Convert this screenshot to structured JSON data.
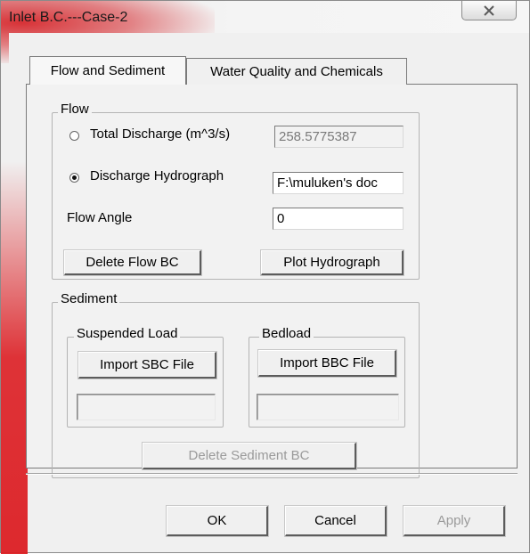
{
  "window": {
    "title": "Inlet B.C.---Case-2",
    "close_icon": "close-icon"
  },
  "tabs": [
    {
      "label": "Flow and Sediment",
      "active": true
    },
    {
      "label": "Water Quality and Chemicals",
      "active": false
    }
  ],
  "flow": {
    "group_label": "Flow",
    "total_discharge": {
      "label": "Total Discharge (m^3/s)",
      "selected": false,
      "value": "258.5775387"
    },
    "discharge_hydrograph": {
      "label": "Discharge Hydrograph",
      "selected": true,
      "value": "F:\\muluken's doc"
    },
    "flow_angle": {
      "label": "Flow Angle",
      "value": "0"
    },
    "delete_button": "Delete Flow BC",
    "plot_button": "Plot Hydrograph"
  },
  "sediment": {
    "group_label": "Sediment",
    "suspended": {
      "group_label": "Suspended Load",
      "import_button": "Import SBC File",
      "file_value": ""
    },
    "bedload": {
      "group_label": "Bedload",
      "import_button": "Import BBC File",
      "file_value": ""
    },
    "delete_button": "Delete Sediment BC"
  },
  "footer": {
    "ok": "OK",
    "cancel": "Cancel",
    "apply": "Apply"
  },
  "colors": {
    "accent_red": "#d7282d",
    "face": "#f0f0f0",
    "disabled_text": "#9a9a9a"
  }
}
